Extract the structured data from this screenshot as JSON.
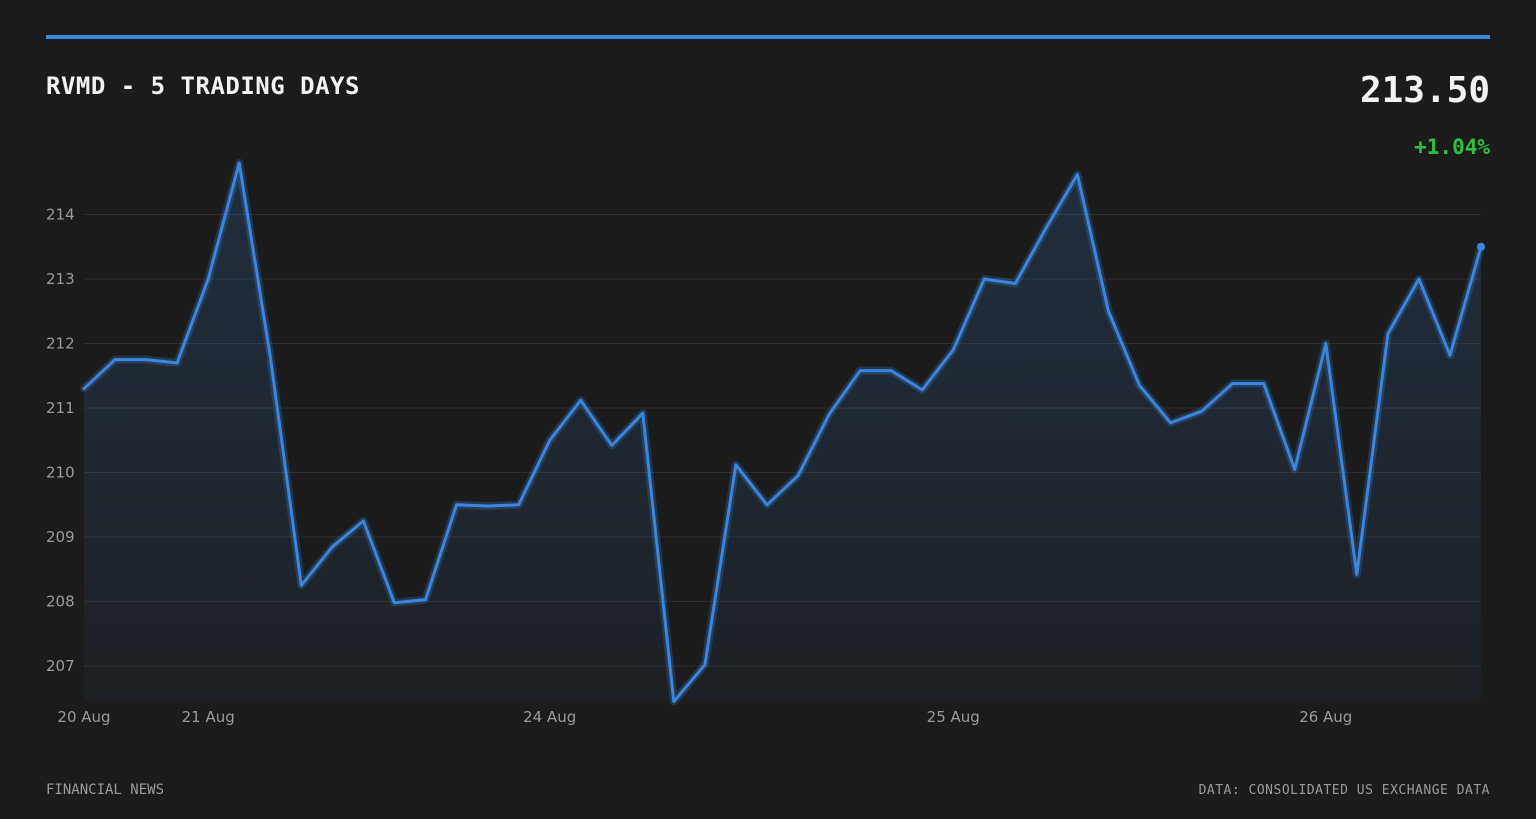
{
  "header": {
    "title": "RVMD - 5 TRADING DAYS",
    "price": "213.50",
    "change": "+1.04%"
  },
  "footer": {
    "left": "FINANCIAL NEWS",
    "right": "DATA: CONSOLIDATED US EXCHANGE DATA"
  },
  "colors": {
    "background": "#1b1b1b",
    "accent": "#3a86de",
    "positive": "#2fbf3f",
    "grid": "#2e2e2e",
    "text_muted": "#9a9a9a",
    "text_primary": "#f2f2f2"
  },
  "chart_data": {
    "type": "line",
    "title": "RVMD - 5 TRADING DAYS",
    "xlabel": "",
    "ylabel": "",
    "grid": true,
    "legend": "none",
    "ylim": [
      206.5,
      214.8
    ],
    "yticks": [
      207,
      208,
      209,
      210,
      211,
      212,
      213,
      214
    ],
    "xtick_labels": [
      {
        "index": 0,
        "label": "20 Aug"
      },
      {
        "index": 4,
        "label": "21 Aug"
      },
      {
        "index": 15,
        "label": "24 Aug"
      },
      {
        "index": 28,
        "label": "25 Aug"
      },
      {
        "index": 40,
        "label": "26 Aug"
      }
    ],
    "series": [
      {
        "values": [
          211.3,
          211.75,
          211.75,
          211.7,
          213.0,
          214.8,
          211.8,
          208.25,
          208.85,
          209.25,
          207.98,
          208.03,
          209.5,
          209.48,
          209.5,
          210.5,
          211.12,
          210.42,
          210.92,
          206.45,
          207.02,
          210.12,
          209.5,
          209.95,
          210.9,
          211.58,
          211.58,
          211.28,
          211.9,
          213.0,
          212.93,
          213.8,
          214.62,
          212.5,
          211.35,
          210.77,
          210.95,
          211.38,
          211.38,
          210.05,
          212.0,
          208.42,
          212.15,
          213.0,
          211.82,
          213.5
        ]
      }
    ]
  }
}
